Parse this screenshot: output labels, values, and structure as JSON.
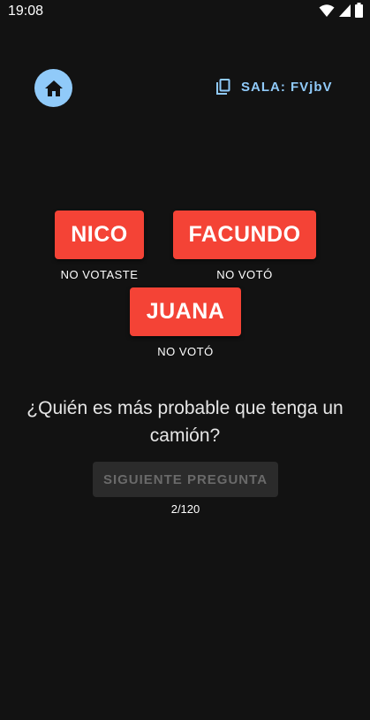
{
  "status_bar": {
    "time": "19:08"
  },
  "header": {
    "home_icon": "home-icon",
    "copy_icon": "copy-icon",
    "room_label": "SALA: FVjbV"
  },
  "players": [
    {
      "name": "NICO",
      "status": "NO VOTASTE"
    },
    {
      "name": "FACUNDO",
      "status": "NO VOTÓ"
    },
    {
      "name": "JUANA",
      "status": "NO VOTÓ"
    }
  ],
  "question": "¿Quién es más probable que tenga un camión?",
  "next_button": {
    "label": "SIGUIENTE PREGUNTA",
    "enabled": false
  },
  "progress": "2/120",
  "colors": {
    "background": "#121212",
    "accent": "#90caf9",
    "player_button": "#f44336",
    "disabled_button": "#2b2b2b"
  }
}
